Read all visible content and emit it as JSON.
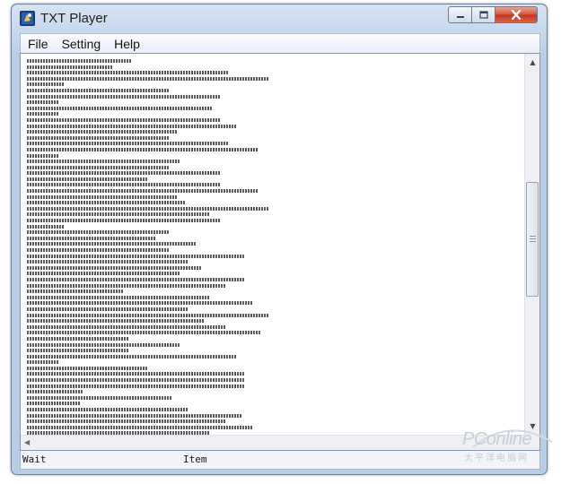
{
  "window": {
    "title": "TXT Player",
    "controls": {
      "minimize_icon": "minimize-icon",
      "maximize_icon": "maximize-icon",
      "close_icon": "close-icon"
    }
  },
  "menu": {
    "items": [
      {
        "label": "File"
      },
      {
        "label": "Setting"
      },
      {
        "label": "Help"
      }
    ]
  },
  "content": {
    "line_count": 64,
    "scroll_position": 0.48
  },
  "status": {
    "left": "Wait",
    "right": "Item"
  },
  "watermark": {
    "brand": "PConline",
    "subtitle": "太平洋电脑网"
  },
  "colors": {
    "titlebar_top": "#d6e3f3",
    "close_button": "#c2341c",
    "text_background": "#ffffff"
  }
}
